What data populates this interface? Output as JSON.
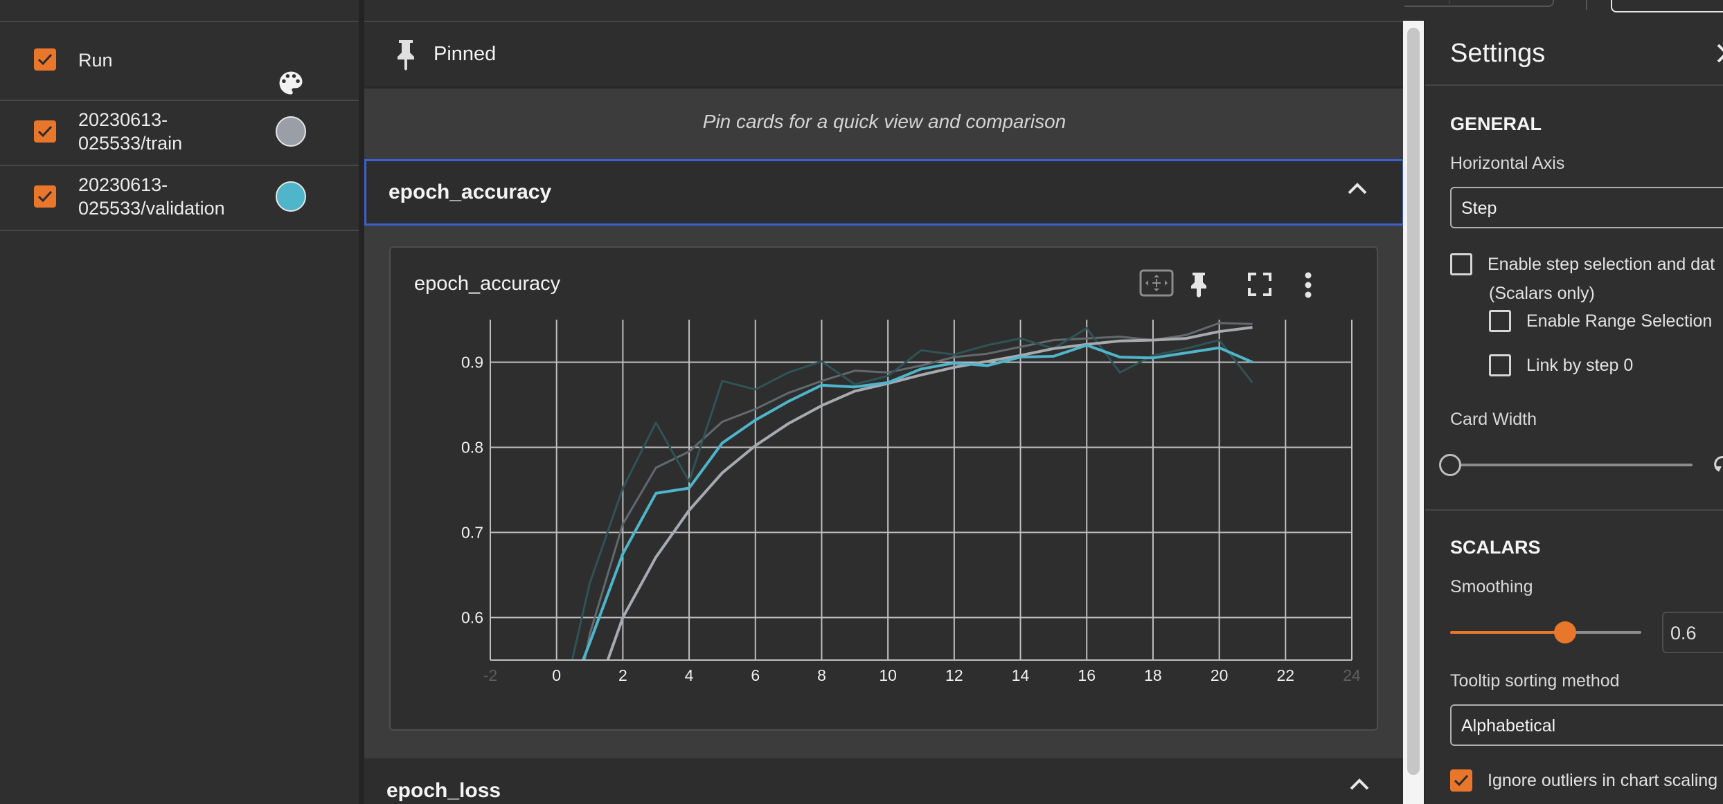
{
  "runs_panel": {
    "header": {
      "label": "Run",
      "checked": true,
      "icon": "palette-icon"
    },
    "runs": [
      {
        "label_line1": "20230613-",
        "label_line2": "025533/train",
        "checked": true,
        "color": "#9a9ea6"
      },
      {
        "label_line1": "20230613-",
        "label_line2": "025533/validation",
        "checked": true,
        "color": "#4eb5cb"
      }
    ]
  },
  "main": {
    "pinned": {
      "title": "Pinned",
      "empty_message": "Pin cards for a quick view and comparison"
    },
    "groups": [
      {
        "title": "epoch_accuracy",
        "expanded": true
      },
      {
        "title": "epoch_loss",
        "expanded": true
      }
    ],
    "card": {
      "title": "epoch_accuracy",
      "toolbar_icons": [
        "fit-to-domain-icon",
        "pin-icon",
        "fullscreen-icon",
        "more-vert-icon"
      ]
    }
  },
  "chart_data": {
    "type": "line",
    "title": "epoch_accuracy",
    "xlabel": "",
    "ylabel": "",
    "xlim": [
      -2,
      24
    ],
    "ylim": [
      0.55,
      0.95
    ],
    "x_ticks": [
      -2,
      0,
      2,
      4,
      6,
      8,
      10,
      12,
      14,
      16,
      18,
      20,
      22,
      24
    ],
    "x_tick_labels": [
      "-2",
      "0",
      "2",
      "4",
      "6",
      "8",
      "10",
      "12",
      "14",
      "16",
      "18",
      "20",
      "22",
      "24"
    ],
    "y_ticks": [
      0.6,
      0.7,
      0.8,
      0.9
    ],
    "y_tick_labels": [
      "0.6",
      "0.7",
      "0.8",
      "0.9"
    ],
    "grid": true,
    "series": [
      {
        "run": "train",
        "style": "raw",
        "color": "#62696f",
        "x": [
          0,
          1,
          2,
          3,
          4,
          5,
          6,
          7,
          8,
          9,
          10,
          11,
          12,
          13,
          14,
          15,
          16,
          17,
          18,
          19,
          20,
          21
        ],
        "y": [
          0.38,
          0.58,
          0.71,
          0.776,
          0.795,
          0.83,
          0.845,
          0.864,
          0.878,
          0.89,
          0.888,
          0.896,
          0.906,
          0.91,
          0.918,
          0.926,
          0.928,
          0.93,
          0.926,
          0.932,
          0.946,
          0.945
        ]
      },
      {
        "run": "validation",
        "style": "raw",
        "color": "#2f5357",
        "x": [
          0,
          1,
          2,
          3,
          4,
          5,
          6,
          7,
          8,
          9,
          10,
          11,
          12,
          13,
          14,
          15,
          16,
          17,
          18,
          19,
          20,
          21
        ],
        "y": [
          0.47,
          0.64,
          0.752,
          0.829,
          0.76,
          0.878,
          0.868,
          0.888,
          0.901,
          0.874,
          0.884,
          0.914,
          0.909,
          0.92,
          0.928,
          0.916,
          0.94,
          0.888,
          0.908,
          0.916,
          0.926,
          0.876
        ]
      },
      {
        "run": "train",
        "style": "smoothed",
        "color": "#a7abb0",
        "x": [
          0,
          1,
          2,
          3,
          4,
          5,
          6,
          7,
          8,
          9,
          10,
          11,
          12,
          13,
          14,
          15,
          16,
          17,
          18,
          19,
          20,
          21
        ],
        "y": [
          0.38,
          0.49,
          0.6,
          0.671,
          0.726,
          0.77,
          0.802,
          0.828,
          0.849,
          0.866,
          0.875,
          0.885,
          0.894,
          0.901,
          0.908,
          0.916,
          0.921,
          0.925,
          0.926,
          0.928,
          0.936,
          0.941
        ]
      },
      {
        "run": "validation",
        "style": "smoothed",
        "color": "#4eb5cb",
        "x": [
          0,
          1,
          2,
          3,
          4,
          5,
          6,
          7,
          8,
          9,
          10,
          11,
          12,
          13,
          14,
          15,
          16,
          17,
          18,
          19,
          20,
          21
        ],
        "y": [
          0.47,
          0.57,
          0.675,
          0.746,
          0.752,
          0.805,
          0.832,
          0.854,
          0.873,
          0.871,
          0.876,
          0.892,
          0.899,
          0.896,
          0.906,
          0.907,
          0.92,
          0.906,
          0.905,
          0.911,
          0.917,
          0.9
        ]
      }
    ]
  },
  "settings": {
    "title": "Settings",
    "general": {
      "heading": "GENERAL",
      "horizontal_axis_label": "Horizontal Axis",
      "horizontal_axis_value": "Step",
      "step_selection_label": "Enable step selection and dat",
      "step_selection_sub": "(Scalars only)",
      "step_selection_checked": false,
      "range_selection_label": "Enable Range Selection",
      "range_selection_checked": false,
      "link_by_step_label": "Link by step 0",
      "link_by_step_checked": false,
      "card_width_label": "Card Width",
      "card_width_fraction": 0.0
    },
    "scalars": {
      "heading": "SCALARS",
      "smoothing_label": "Smoothing",
      "smoothing_value": "0.6",
      "smoothing_fraction": 0.6,
      "tooltip_sort_label": "Tooltip sorting method",
      "tooltip_sort_value": "Alphabetical",
      "ignore_outliers_label": "Ignore outliers in chart scaling",
      "ignore_outliers_checked": true
    }
  },
  "colors": {
    "accent": "#e8762b",
    "focus_border": "#3d5fd0",
    "grid": "#bfbfbf"
  }
}
